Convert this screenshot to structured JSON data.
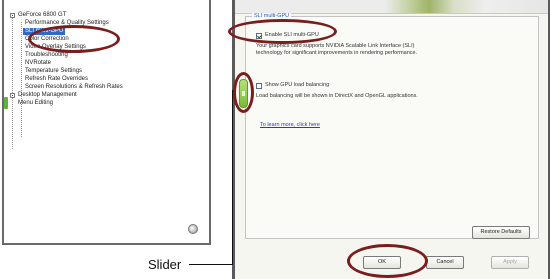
{
  "tree": {
    "root_label": "GeForce 6800 GT",
    "items": [
      "Performance & Quality Settings",
      "SLI multi-GPU",
      "Color Correction",
      "Video Overlay Settings",
      "Troubleshooting",
      "NVRotate",
      "Temperature Settings",
      "Refresh Rate Overrides",
      "Screen Resolutions & Refresh Rates"
    ],
    "other_items": [
      "Desktop Management",
      "Menu Editing"
    ]
  },
  "settings": {
    "group_title": "SLI multi-GPU",
    "enable_sli_label": "Enable SLI multi-GPU",
    "enable_sli_checked": true,
    "enable_sli_description": [
      "Your graphics card supports NVIDIA Scalable Link Interface (SLI)",
      "technology for significant improvements in rendering performance."
    ],
    "show_load_label": "Show GPU load balancing",
    "show_load_checked": false,
    "show_load_description": "Load balancing will be shown in DirectX and OpenGL applications.",
    "learn_more": "To learn more, click here"
  },
  "buttons": {
    "restore": "Restore Defaults",
    "ok": "OK",
    "cancel": "Cancel",
    "apply": "Apply"
  },
  "annotation": {
    "callout": "Slider"
  },
  "colors": {
    "ellipse": "#7a1d1d",
    "highlight": "#3169c6",
    "slider": "#79bb35",
    "link": "#1f3fbf"
  }
}
